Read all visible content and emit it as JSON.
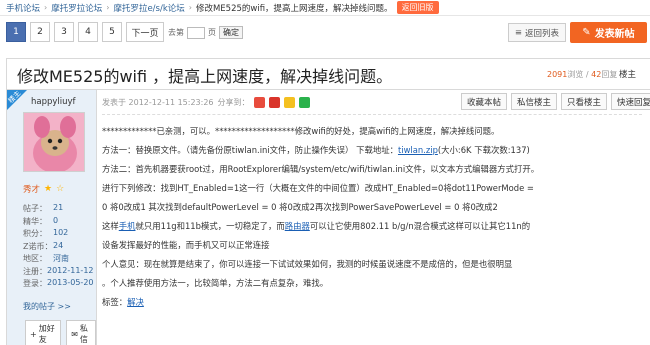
{
  "breadcrumb": {
    "items": [
      "手机论坛",
      "摩托罗拉论坛",
      "摩托罗拉e/s/k论坛"
    ],
    "current": "修改ME525的wifi，提高上网速度，解决掉线问题。",
    "back_label": "返回旧版"
  },
  "pager": {
    "pages": [
      "1",
      "2",
      "3",
      "4",
      "5"
    ],
    "next_label": "下一页",
    "goto_label": "去第",
    "goto_unit": "页",
    "confirm_label": "确定",
    "back_list_label": "返回列表",
    "new_post_label": "发表新帖"
  },
  "post": {
    "title": "修改ME525的wifi ，提高上网速度，解决掉线问题。",
    "views": "2091",
    "views_unit": "浏览",
    "replies": "42",
    "replies_unit": "回复",
    "floor_label": "楼主"
  },
  "author": {
    "badge": "楼主",
    "username": "happyliuyf",
    "rank": "秀才",
    "info": [
      {
        "k": "帖子：",
        "v": "21"
      },
      {
        "k": "精华：",
        "v": "0"
      },
      {
        "k": "积分：",
        "v": "102"
      },
      {
        "k": "Z诺币：",
        "v": "24"
      },
      {
        "k": "地区：",
        "v": "河南"
      },
      {
        "k": "注册：",
        "v": "2012-11-12"
      },
      {
        "k": "登录：",
        "v": "2013-05-20"
      }
    ],
    "more_label": "我的帖子 >>",
    "add_friend_label": "加好友",
    "message_label": "私信"
  },
  "meta": {
    "posted": "发表于 2012-12-11 15:23:26",
    "share_label": "分享到："
  },
  "actions": [
    "收藏本帖",
    "私信楼主",
    "只看楼主",
    "快速回复"
  ],
  "body": {
    "l1": "*************已亲测，可以。*******************修改wifi的好处，提高wifi的上网速度，解决掉线问题。",
    "l2a": "方法一：替换原文件。（请先备份原tiwlan.ini文件，防止操作失误）  下载地址：",
    "l2link": "tiwlan.zip",
    "l2b": "(大小:6K 下载次数:137)",
    "l3": "方法二：首先机器要获root过，用RootExplorer编辑/system/etc/wifi/tiwlan.ini文件，以文本方式编辑器方式打开。",
    "l4": "进行下列修改：找到HT_Enabled=1这一行（大概在文件的中间位置）改成HT_Enabled=0将dot11PowerMode =",
    "l5": "0 将0改成1 其次找到defaultPowerLevel = 0 将0改成2再次找到PowerSavePowerLevel = 0 将0改成2",
    "l6a": "这样",
    "l6kw1": "手机",
    "l6b": "就只用11g和11b模式，一切稳定了，而",
    "l6kw2": "路由器",
    "l6c": "可以让它使用802.11 b/g/n混合模式这样可以让其它11n的",
    "l7": "设备发挥最好的性能，而手机又可以正常连接",
    "l8": "个人意见：现在就算是结束了，你可以连接一下试试效果如何，我测的时候虽说速度不是成倍的，但是也很明显",
    "l9": "。个人推荐使用方法一，比较简单，方法二有点复杂，难找。",
    "tags_label": "标签：",
    "tag": "解决"
  },
  "colors": {
    "accent_blue": "#4a6fb0",
    "new_post_orange": "#f26522",
    "side_bg": "#e8f0f8"
  }
}
